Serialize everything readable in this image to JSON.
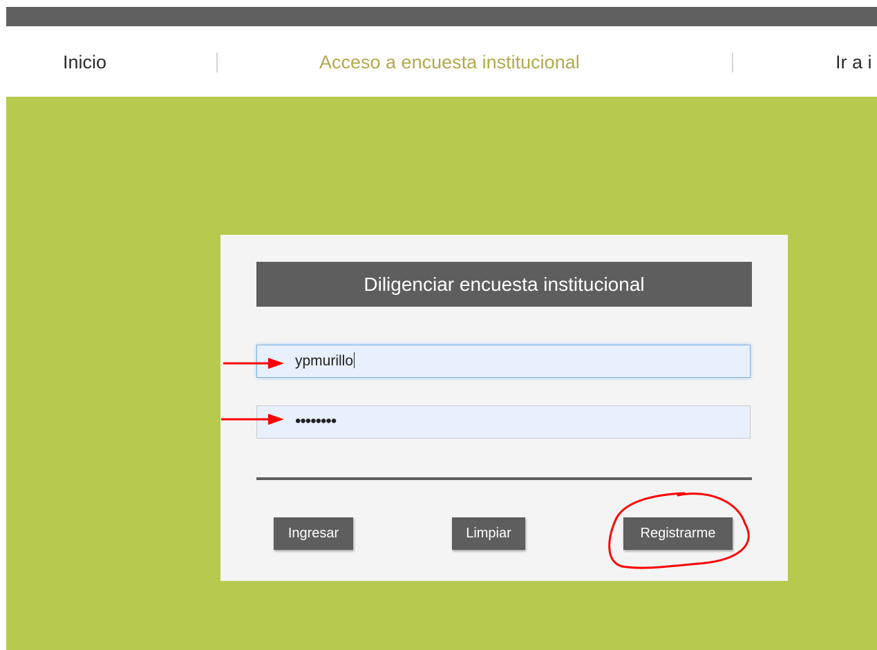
{
  "nav": {
    "home": "Inicio",
    "survey_access": "Acceso a encuesta institucional",
    "more": "Ir a i"
  },
  "form": {
    "title": "Diligenciar encuesta institucional",
    "username_value": "ypmurillo",
    "password_display": "••••••••",
    "buttons": {
      "login": "Ingresar",
      "clear": "Limpiar",
      "register": "Registrarme"
    }
  },
  "colors": {
    "background_green": "#b8ca4e",
    "nav_active": "#b2a94d",
    "dark_gray": "#5e5e5e",
    "annotation_red": "#ff0000"
  },
  "annotations": {
    "arrows": [
      "arrow-right-icon",
      "arrow-right-icon"
    ],
    "highlight": "red-circle-around-register-button"
  }
}
